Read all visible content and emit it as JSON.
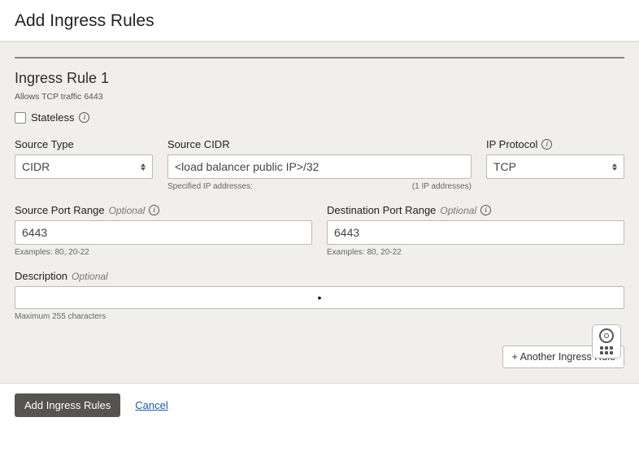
{
  "header": {
    "title": "Add Ingress Rules"
  },
  "rule": {
    "title": "Ingress Rule 1",
    "subtitle": "Allows TCP traffic 6443",
    "stateless_label": "Stateless",
    "stateless_checked": false,
    "source_type": {
      "label": "Source Type",
      "value": "CIDR"
    },
    "source_cidr": {
      "label": "Source CIDR",
      "value": "<load balancer public IP>/32",
      "hint_left": "Specified IP addresses:",
      "hint_right": "(1 IP addresses)"
    },
    "ip_protocol": {
      "label": "IP Protocol",
      "value": "TCP"
    },
    "source_port": {
      "label": "Source Port Range",
      "optional": "Optional",
      "value": "6443",
      "hint": "Examples: 80, 20-22"
    },
    "dest_port": {
      "label": "Destination Port Range",
      "optional": "Optional",
      "value": "6443",
      "hint": "Examples: 80, 20-22"
    },
    "description": {
      "label": "Description",
      "optional": "Optional",
      "hint": "Maximum 255 characters"
    },
    "another_button": "+ Another Ingress Rule"
  },
  "footer": {
    "submit": "Add Ingress Rules",
    "cancel": "Cancel"
  }
}
